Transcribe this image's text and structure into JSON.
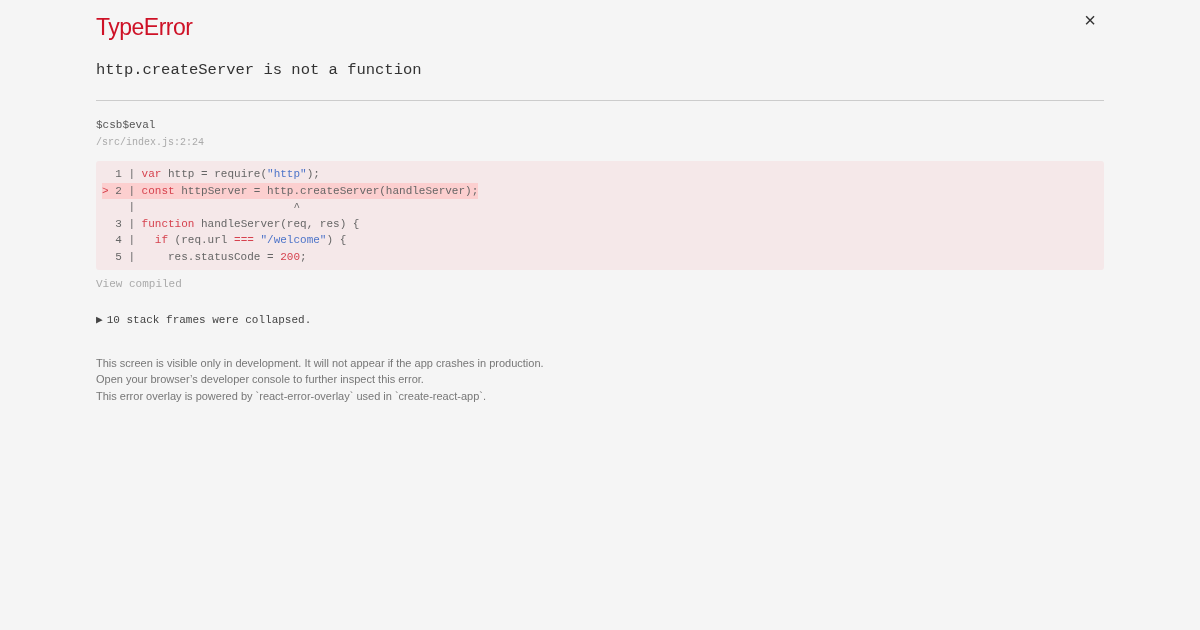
{
  "header": {
    "title": "TypeError",
    "close": "×",
    "message": "http.createServer is not a function"
  },
  "frame": {
    "function": "$csb$eval",
    "location": "/src/index.js:2:24"
  },
  "code_lines": [
    {
      "highlighted": false,
      "tokens": [
        {
          "kind": "plain",
          "text": "  1 | "
        },
        {
          "kind": "keyword",
          "text": "var"
        },
        {
          "kind": "plain",
          "text": " http = require("
        },
        {
          "kind": "string",
          "text": "\"http\""
        },
        {
          "kind": "plain",
          "text": ");"
        }
      ]
    },
    {
      "highlighted": true,
      "tokens": [
        {
          "kind": "marker",
          "text": "> "
        },
        {
          "kind": "plain",
          "text": "2 | "
        },
        {
          "kind": "keyword",
          "text": "const"
        },
        {
          "kind": "plain",
          "text": " httpServer = http.createServer(handleServer);"
        }
      ]
    },
    {
      "highlighted": false,
      "tokens": [
        {
          "kind": "plain",
          "text": "    |                        ^"
        }
      ]
    },
    {
      "highlighted": false,
      "tokens": [
        {
          "kind": "plain",
          "text": "  3 | "
        },
        {
          "kind": "keyword",
          "text": "function"
        },
        {
          "kind": "plain",
          "text": " handleServer(req, res) {"
        }
      ]
    },
    {
      "highlighted": false,
      "tokens": [
        {
          "kind": "plain",
          "text": "  4 |   "
        },
        {
          "kind": "keyword",
          "text": "if"
        },
        {
          "kind": "plain",
          "text": " (req.url "
        },
        {
          "kind": "keyword",
          "text": "=== "
        },
        {
          "kind": "string",
          "text": "\"/welcome\""
        },
        {
          "kind": "plain",
          "text": ") {"
        }
      ]
    },
    {
      "highlighted": false,
      "tokens": [
        {
          "kind": "plain",
          "text": "  5 |     res.statusCode = "
        },
        {
          "kind": "number",
          "text": "200"
        },
        {
          "kind": "plain",
          "text": ";"
        }
      ]
    }
  ],
  "view_compiled": "View compiled",
  "collapsed": {
    "arrow": "▶",
    "text": "10 stack frames were collapsed."
  },
  "footer": [
    "This screen is visible only in development. It will not appear if the app crashes in production.",
    "Open your browser’s developer console to further inspect this error.",
    "This error overlay is powered by `react-error-overlay` used in `create-react-app`."
  ]
}
